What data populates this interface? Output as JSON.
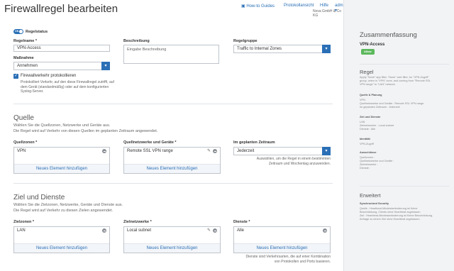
{
  "page": {
    "title": "Firewallregel bearbeiten"
  },
  "topnav": {
    "how_to": "How-to Guides",
    "log": "Protokollansicht",
    "help": "Hilfe",
    "admin": "admin",
    "company": "Nova GmbH & Co KG"
  },
  "form": {
    "status_toggle": "ON",
    "status_label": "Regelstatus",
    "rule_name_label": "Regelname *",
    "rule_name_value": "VPN-Access",
    "description_label": "Beschreibung",
    "description_placeholder": "Eingabe Beschreibung",
    "group_label": "Regelgruppe",
    "group_value": "Traffic to Internal Zones",
    "action_label": "Maßnahme",
    "action_value": "Annehmen",
    "log_checkbox_label": "Firewallverkehr protokollieren",
    "log_help": [
      "Protokolliert Verkehr, auf den diese Firewallregel zutrifft, auf",
      "dem Gerät (standardmäßig) oder auf dem konfigurierten",
      "Syslog-Server."
    ]
  },
  "source": {
    "title": "Quelle",
    "desc1": "Wählen Sie die Quellzonen, Netzwerke und Geräte aus.",
    "desc2": "Die Regel wird auf Verkehr von diesen Quellen im geplanten Zeitraum angewendet.",
    "zones_label": "Quellzonen *",
    "zones_value": "VPN",
    "networks_label": "Quellnetzwerke und Geräte *",
    "networks_value": "Remote SSL VPN range",
    "schedule_label": "Im geplanten Zeitraum",
    "schedule_value": "Jederzeit",
    "schedule_help": [
      "Auswählen, um die Regel in einem bestimmten",
      "Zeitraum und Wochentag anzuwenden."
    ],
    "add_label": "Neues Element hinzufügen"
  },
  "dest": {
    "title": "Ziel und Dienste",
    "desc1": "Wählen Sie die Zielzonen, Netzwerke, Geräte und Dienste aus.",
    "desc2": "Die Regel wird auf Verkehr zu diesen Zielen angewendet.",
    "zones_label": "Zielzonen *",
    "zones_value": "LAN",
    "networks_label": "Zielnetzwerke *",
    "networks_value": "Local subnet",
    "services_label": "Dienste *",
    "services_value": "Alle",
    "services_help": [
      "Dienste sind Verkehrsarten, die auf einer Kombination",
      "von Protokollen und Ports basieren."
    ],
    "add_label": "Neues Element hinzufügen"
  },
  "summary": {
    "title": "Zusammenfassung",
    "rule_name": "VPN-Access",
    "badge": "Allow",
    "rule_heading": "Regel",
    "rule_text": [
      "Apply \"None\" app filter, \"None\" web filter, for \"VPN-Zugriff\"",
      "group, when in \"VPN\" zone, and coming from \"Remote SSL",
      "VPN range\" to \"LAN\" network."
    ],
    "src_heading": "Quelle & Planung",
    "src_lines": [
      "VPN",
      "Quellnetzwerke und Geräte : Remote SSL VPN range",
      "Im geplanten Zeitraum : Jederzeit"
    ],
    "dst_heading": "Ziel und Dienste",
    "dst_lines": [
      "LAN",
      "Zielnetzwerke : Local subnet",
      "Dienste : Alle"
    ],
    "id_heading": "Identität",
    "id_lines": [
      "VPN-Zugriff"
    ],
    "ex_heading": "Ausschlüsse",
    "ex_lines": [
      "Quellzonen :",
      "Quellnetzwerke und Geräte :",
      "Zielnetzwerke :",
      "Dienste :"
    ],
    "adv_heading": "Erweitert",
    "sync_heading": "Synchronized Security",
    "sync_lines": [
      "Quelle : Heartbeat-Mindestanforderung ist Keine",
      "Beschränkung, Clients ohne Heartbeat zugelassen",
      "Ziel : Heartbeat-Mindestanforderung ist Keine Beschränkung,",
      "Anfrage zu einem Ziel ohne Heartbeat zugelassen."
    ]
  }
}
